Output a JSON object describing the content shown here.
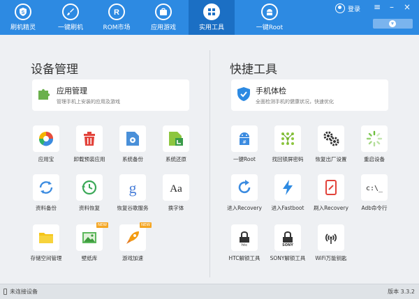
{
  "nav": {
    "items": [
      {
        "label": "刷机精灵",
        "icon": "shield-s-icon"
      },
      {
        "label": "一键刷机",
        "icon": "brush-icon"
      },
      {
        "label": "ROM市场",
        "icon": "rom-r-icon"
      },
      {
        "label": "应用游戏",
        "icon": "bag-icon"
      },
      {
        "label": "实用工具",
        "icon": "grid-icon",
        "active": true
      },
      {
        "label": "一键Root",
        "icon": "android-icon"
      }
    ]
  },
  "topright": {
    "login_label": "登录",
    "menu_icon": "menu-icon",
    "minimize_icon": "minimize-icon",
    "close_icon": "close-icon",
    "download_icon": "download-icon"
  },
  "colors": {
    "brand": "#2d8ae2",
    "active_tab": "#1b6fc4",
    "badge": "#f5a623"
  },
  "left": {
    "title": "设备管理",
    "card": {
      "title": "应用管理",
      "subtitle": "管理手机上安装的应用及游戏",
      "icon": "puzzle-icon"
    },
    "tools": [
      {
        "label": "应用宝",
        "icon": "app-store-icon"
      },
      {
        "label": "卸载预装应用",
        "icon": "trash-icon"
      },
      {
        "label": "系统备份",
        "icon": "system-backup-icon"
      },
      {
        "label": "系统还原",
        "icon": "system-restore-icon"
      },
      {
        "label": "资料备份",
        "icon": "sync-icon"
      },
      {
        "label": "资料恢复",
        "icon": "clock-restore-icon"
      },
      {
        "label": "恢复谷歌服务",
        "icon": "google-icon"
      },
      {
        "label": "换字体",
        "icon": "font-icon",
        "glyph": "Aa"
      },
      {
        "label": "存储空间管理",
        "icon": "folder-icon"
      },
      {
        "label": "壁纸库",
        "icon": "wallpaper-icon",
        "badge": "NEW"
      },
      {
        "label": "游戏加速",
        "icon": "rocket-icon",
        "badge": "NEW"
      }
    ]
  },
  "right": {
    "title": "快捷工具",
    "card": {
      "title": "手机体检",
      "subtitle": "全面检测手机的健康状况，快速优化",
      "icon": "shield-check-icon"
    },
    "tools": [
      {
        "label": "一键Root",
        "icon": "android-root-icon"
      },
      {
        "label": "找回锁屏密码",
        "icon": "pattern-lock-icon"
      },
      {
        "label": "恢复出厂设置",
        "icon": "gears-icon"
      },
      {
        "label": "重启设备",
        "icon": "loading-icon"
      },
      {
        "label": "进入Recovery",
        "icon": "refresh-icon"
      },
      {
        "label": "进入Fastboot",
        "icon": "lightning-icon"
      },
      {
        "label": "刷入Recovery",
        "icon": "tablet-icon"
      },
      {
        "label": "Adb命令行",
        "icon": "terminal-icon",
        "glyph": "c:\\_"
      },
      {
        "label": "HTC解锁工具",
        "icon": "htc-lock-icon",
        "glyph": "htc"
      },
      {
        "label": "SONY解锁工具",
        "icon": "sony-lock-icon",
        "glyph": "SONY"
      },
      {
        "label": "WiFi万能钥匙",
        "icon": "wifi-key-icon"
      }
    ]
  },
  "status": {
    "device_status": "未连接设备",
    "version": "版本 3.3.2"
  }
}
